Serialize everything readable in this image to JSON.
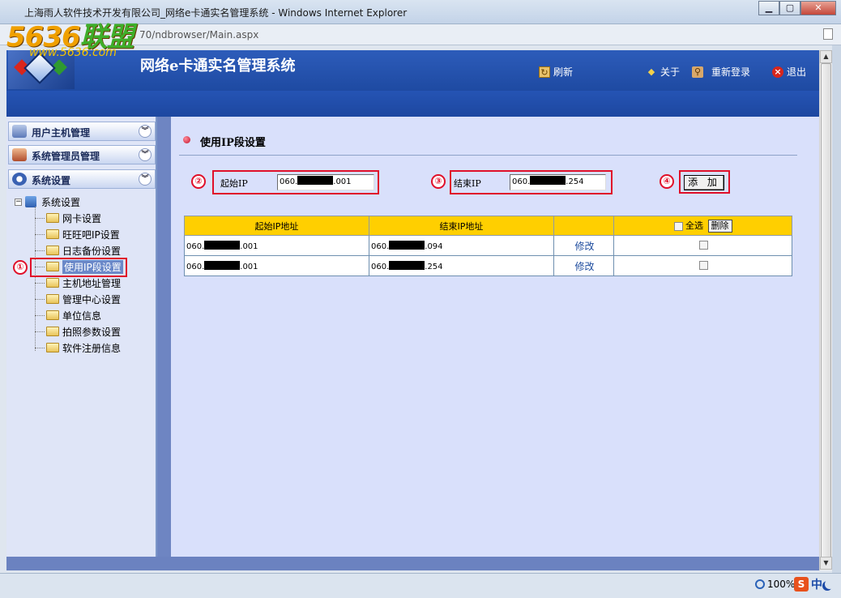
{
  "window": {
    "title": "上海雨人软件技术开发有限公司_网络e卡通实名管理系统 - Windows Internet Explorer",
    "address": "70/ndbrowser/Main.aspx",
    "minimize": "▁",
    "maximize": "▢",
    "close": "✕"
  },
  "watermark": {
    "logo_digits": "5636",
    "logo_cn": "联盟",
    "url": "www.5636.com"
  },
  "header": {
    "app_title": "网络e卡通实名管理系统",
    "refresh_label": "刷新",
    "about_label": "关于",
    "relogin_label": "重新登录",
    "exit_label": "退出"
  },
  "sidebar": {
    "sections": [
      {
        "label": "用户主机管理"
      },
      {
        "label": "系统管理员管理"
      },
      {
        "label": "系统设置"
      }
    ],
    "tree_root": "系统设置",
    "tree_items": [
      {
        "label": "网卡设置"
      },
      {
        "label": "旺旺吧IP设置"
      },
      {
        "label": "日志备份设置"
      },
      {
        "label": "使用IP段设置"
      },
      {
        "label": "主机地址管理"
      },
      {
        "label": "管理中心设置"
      },
      {
        "label": "单位信息"
      },
      {
        "label": "拍照参数设置"
      },
      {
        "label": "软件注册信息"
      }
    ],
    "selected_index": 3
  },
  "main": {
    "section_title": "使用IP段设置",
    "start_ip_label": "起始IP",
    "start_ip_prefix": "060.",
    "start_ip_suffix": ".001",
    "end_ip_label": "结束IP",
    "end_ip_prefix": "060.",
    "end_ip_suffix": ".254",
    "add_button": "添 加",
    "table": {
      "headers": [
        "起始IP地址",
        "结束IP地址",
        "",
        "全选"
      ],
      "delete_button": "删除",
      "rows": [
        {
          "start_prefix": "060.",
          "start_suffix": ".001",
          "end_prefix": "060.",
          "end_suffix": ".094",
          "action": "修改"
        },
        {
          "start_prefix": "060.",
          "start_suffix": ".001",
          "end_prefix": "060.",
          "end_suffix": ".254",
          "action": "修改"
        }
      ]
    }
  },
  "annotations": [
    "①",
    "②",
    "③",
    "④"
  ],
  "statusbar": {
    "zoom": "100%",
    "ime_s": "S",
    "ime_lang": "中"
  },
  "colors": {
    "header_blue": "#1e4aa2",
    "table_header": "#ffcf00",
    "annotation_red": "#e0102a",
    "content_bg": "#d9e0fb"
  }
}
